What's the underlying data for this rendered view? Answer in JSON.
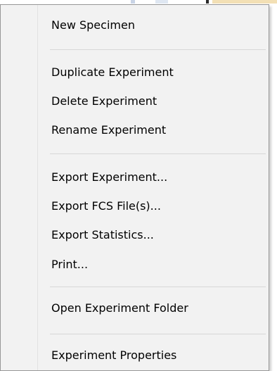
{
  "menu": {
    "items": [
      {
        "label": "New Specimen"
      },
      {
        "label": "Duplicate Experiment"
      },
      {
        "label": "Delete Experiment"
      },
      {
        "label": "Rename Experiment"
      },
      {
        "label": "Export Experiment..."
      },
      {
        "label": "Export FCS File(s)..."
      },
      {
        "label": "Export Statistics..."
      },
      {
        "label": "Print..."
      },
      {
        "label": "Open Experiment Folder"
      },
      {
        "label": "Experiment Properties"
      }
    ]
  },
  "colors": {
    "menu_background": "#f2f2f2",
    "menu_border": "#979797",
    "separator": "#d7d7d7",
    "text": "#000000"
  }
}
